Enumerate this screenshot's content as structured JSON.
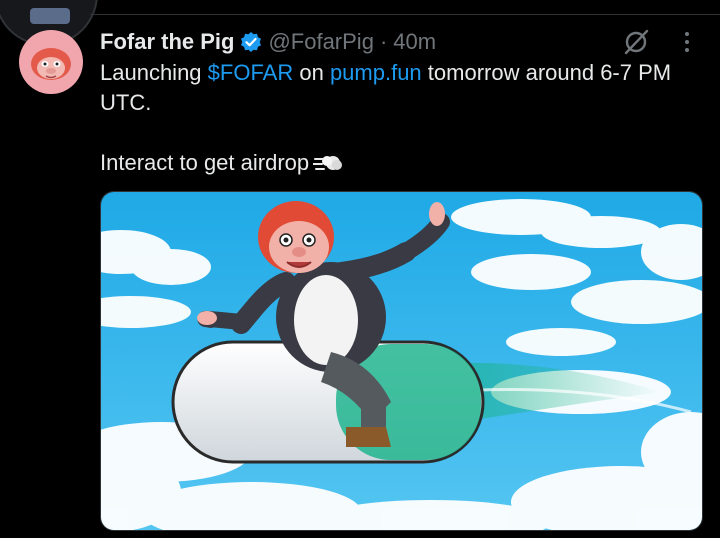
{
  "tweet": {
    "author_name": "Fofar the Pig",
    "handle": "@FofarPig",
    "separator": "·",
    "time": "40m",
    "text": {
      "line1_pre": "Launching ",
      "cashtag": "$FOFAR",
      "line1_mid": " on ",
      "link": "pump.fun",
      "line1_post": " tomorrow around 6-7 PM UTC.",
      "line2": "Interact to get airdrop"
    }
  },
  "icons": {
    "verified": "verified-badge-icon",
    "grok": "grok-icon",
    "more": "more-options-icon",
    "dash": "dashing-away-emoji-icon"
  },
  "colors": {
    "background": "#000000",
    "text": "#e7e9ea",
    "secondary_text": "#71767b",
    "link": "#1d9bf0",
    "avatar_bg": "#f1a6ae",
    "sky": "#29b6ec"
  }
}
